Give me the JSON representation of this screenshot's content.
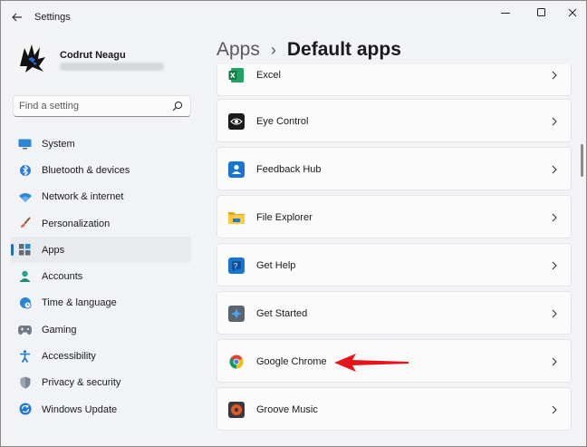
{
  "window": {
    "title": "Settings"
  },
  "user": {
    "name": "Codrut Neagu"
  },
  "search": {
    "placeholder": "Find a setting"
  },
  "sidebar": {
    "items": [
      {
        "label": "System",
        "icon": "monitor-icon"
      },
      {
        "label": "Bluetooth & devices",
        "icon": "bluetooth-icon"
      },
      {
        "label": "Network & internet",
        "icon": "wifi-icon"
      },
      {
        "label": "Personalization",
        "icon": "brush-icon"
      },
      {
        "label": "Apps",
        "icon": "apps-icon",
        "selected": true
      },
      {
        "label": "Accounts",
        "icon": "person-icon"
      },
      {
        "label": "Time & language",
        "icon": "globe-clock-icon"
      },
      {
        "label": "Gaming",
        "icon": "gamepad-icon"
      },
      {
        "label": "Accessibility",
        "icon": "accessibility-icon"
      },
      {
        "label": "Privacy & security",
        "icon": "shield-icon"
      },
      {
        "label": "Windows Update",
        "icon": "update-icon"
      }
    ]
  },
  "breadcrumb": {
    "parent": "Apps",
    "separator": "›",
    "current": "Default apps"
  },
  "apps": [
    {
      "name": "Excel",
      "icon": "excel-icon"
    },
    {
      "name": "Eye Control",
      "icon": "eye-control-icon"
    },
    {
      "name": "Feedback Hub",
      "icon": "feedback-hub-icon"
    },
    {
      "name": "File Explorer",
      "icon": "file-explorer-icon"
    },
    {
      "name": "Get Help",
      "icon": "get-help-icon"
    },
    {
      "name": "Get Started",
      "icon": "get-started-icon"
    },
    {
      "name": "Google Chrome",
      "icon": "chrome-icon"
    },
    {
      "name": "Groove Music",
      "icon": "groove-music-icon"
    }
  ],
  "colors": {
    "accent": "#1f6fc5",
    "annotation_arrow": "#e8141c"
  }
}
